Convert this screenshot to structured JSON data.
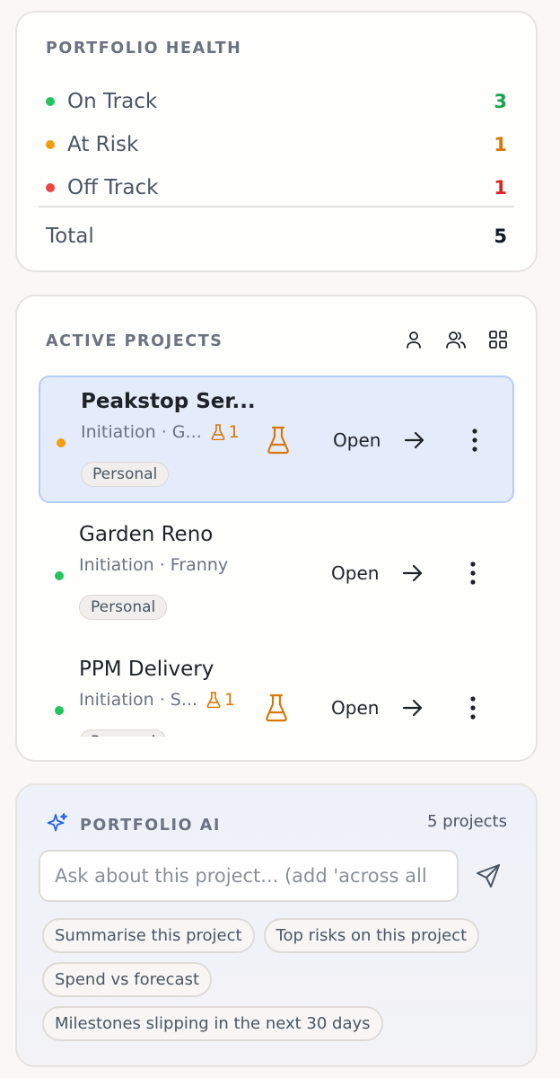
{
  "health": {
    "title": "PORTFOLIO HEALTH",
    "rows": [
      {
        "label": "On Track",
        "count": "3",
        "color": "#22c55e",
        "count_color": "#16a34a"
      },
      {
        "label": "At Risk",
        "count": "1",
        "color": "#f59e0b",
        "count_color": "#d97706"
      },
      {
        "label": "Off Track",
        "count": "1",
        "color": "#ef4444",
        "count_color": "#dc2626"
      }
    ],
    "total_label": "Total",
    "total_count": "5"
  },
  "projects": {
    "title": "ACTIVE PROJECTS",
    "view_icons": [
      "person-icon",
      "people-icon",
      "grid-icon"
    ],
    "items": [
      {
        "name": "Peakstop Ser...",
        "meta": "Initiation · G...",
        "flask_count": "1",
        "badge": "Personal",
        "status_color": "#f59e0b",
        "action": "Open",
        "selected": true,
        "has_flask": true
      },
      {
        "name": "Garden Reno",
        "meta": "Initiation · Franny",
        "flask_count": "",
        "badge": "Personal",
        "status_color": "#22c55e",
        "action": "Open",
        "selected": false,
        "has_flask": false
      },
      {
        "name": "PPM Delivery",
        "meta": "Initiation · S...",
        "flask_count": "1",
        "badge": "Personal",
        "status_color": "#22c55e",
        "action": "Open",
        "selected": false,
        "has_flask": true
      }
    ]
  },
  "ai": {
    "title": "PORTFOLIO AI",
    "count": "5 projects",
    "placeholder": "Ask about this project... (add 'across all",
    "chips": [
      [
        "Summarise this project",
        "Top risks on this project"
      ],
      [
        "Spend vs forecast"
      ],
      [
        "Milestones slipping in the next 30 days"
      ]
    ],
    "accent": "#2563eb"
  }
}
